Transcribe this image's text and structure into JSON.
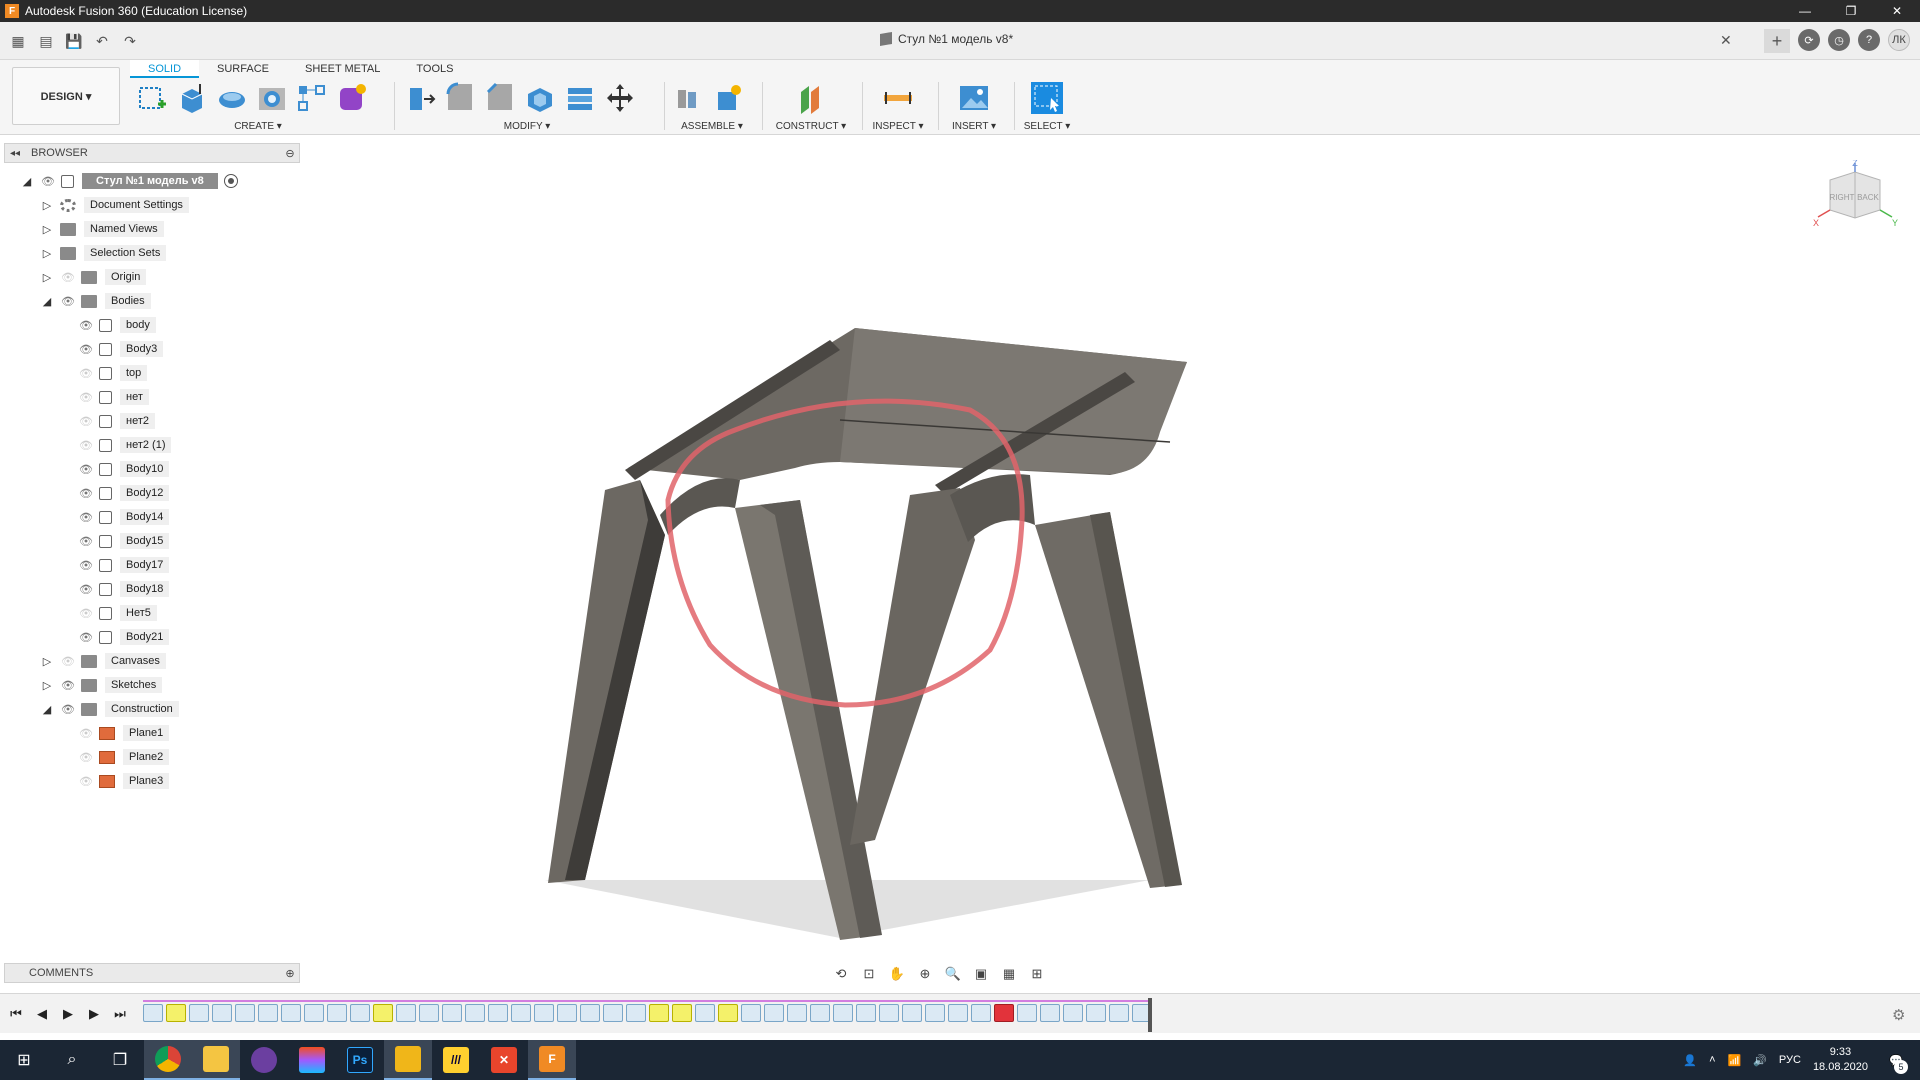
{
  "window": {
    "title": "Autodesk Fusion 360 (Education License)",
    "app_icon": "F",
    "controls": [
      "—",
      "❐",
      "✕"
    ]
  },
  "document": {
    "tab_title": "Стул №1 модель v8*",
    "user_initials": "ЛК"
  },
  "ribbon": {
    "workspace": "DESIGN ▾",
    "tabs": [
      "SOLID",
      "SURFACE",
      "SHEET METAL",
      "TOOLS"
    ],
    "groups": {
      "create": "CREATE ▾",
      "modify": "MODIFY ▾",
      "assemble": "ASSEMBLE ▾",
      "construct": "CONSTRUCT ▾",
      "inspect": "INSPECT ▾",
      "insert": "INSERT ▾",
      "select": "SELECT ▾"
    }
  },
  "browser": {
    "title": "BROWSER",
    "root": "Стул №1 модель v8",
    "items": [
      {
        "label": "Document Settings",
        "icon": "gear-icon"
      },
      {
        "label": "Named Views",
        "icon": "folder-icon"
      },
      {
        "label": "Selection Sets",
        "icon": "folder-icon"
      },
      {
        "label": "Origin",
        "icon": "folder-icon"
      },
      {
        "label": "Bodies",
        "icon": "folder-icon"
      },
      {
        "label": "body",
        "icon": "body-icon"
      },
      {
        "label": "Body3",
        "icon": "body-icon"
      },
      {
        "label": "top",
        "icon": "body-icon"
      },
      {
        "label": "нет",
        "icon": "body-icon"
      },
      {
        "label": "нет2",
        "icon": "body-icon"
      },
      {
        "label": "нет2 (1)",
        "icon": "body-icon"
      },
      {
        "label": "Body10",
        "icon": "body-icon"
      },
      {
        "label": "Body12",
        "icon": "body-icon"
      },
      {
        "label": "Body14",
        "icon": "body-icon"
      },
      {
        "label": "Body15",
        "icon": "body-icon"
      },
      {
        "label": "Body17",
        "icon": "body-icon"
      },
      {
        "label": "Body18",
        "icon": "body-icon"
      },
      {
        "label": "Нет5",
        "icon": "body-icon"
      },
      {
        "label": "Body21",
        "icon": "body-icon"
      },
      {
        "label": "Canvases",
        "icon": "folder-icon"
      },
      {
        "label": "Sketches",
        "icon": "folder-icon"
      },
      {
        "label": "Construction",
        "icon": "folder-icon"
      },
      {
        "label": "Plane1",
        "icon": "plane-icon"
      },
      {
        "label": "Plane2",
        "icon": "plane-icon"
      },
      {
        "label": "Plane3",
        "icon": "plane-icon"
      }
    ]
  },
  "comments": {
    "title": "COMMENTS"
  },
  "viewcube": {
    "right": "RIGHT",
    "back": "BACK",
    "z": "Z",
    "x": "X",
    "y": "Y"
  },
  "taskbar": {
    "lang": "РУС",
    "time": "9:33",
    "date": "18.08.2020",
    "notifications": "5",
    "apps": [
      "Ps",
      "F"
    ]
  },
  "colors": {
    "accent": "#0696d7",
    "model": "#77726b",
    "annotation": "#e0646a"
  }
}
